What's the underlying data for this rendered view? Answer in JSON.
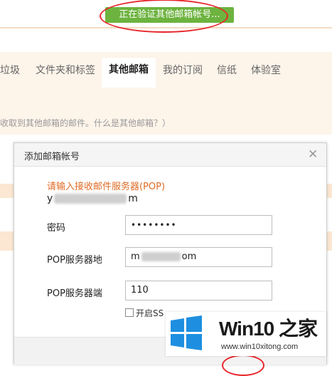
{
  "page": {
    "verify_status": "正在验证其他邮箱帐号...",
    "accent_green": "#6db33f",
    "highlight_red": "#e8262b"
  },
  "tabs": [
    {
      "label": "垃圾",
      "active": false
    },
    {
      "label": "文件夹和标签",
      "active": false
    },
    {
      "label": "其他邮箱",
      "active": true
    },
    {
      "label": "我的订阅",
      "active": false
    },
    {
      "label": "信纸",
      "active": false
    },
    {
      "label": "体验室",
      "active": false
    }
  ],
  "description": "收取到其他邮箱的邮件。什么是其他邮箱？）",
  "dialog": {
    "title": "添加邮箱帐号",
    "close_icon": "close-icon",
    "hint": "请输入接收邮件服务器(POP)",
    "email_prefix": "y",
    "email_suffix": "m",
    "password_label": "密码",
    "password_value": "••••••••",
    "pop_server_label": "POP服务器地",
    "pop_server_prefix": "m",
    "pop_server_suffix": "om",
    "pop_port_label": "POP服务器端",
    "pop_port_value": "110",
    "ssl_label": "开启SS",
    "ssl_checked": false
  },
  "watermark": {
    "title": "Win10 之家",
    "url": "www.win10xitong.com",
    "logo_color": "#1e8fe0"
  }
}
